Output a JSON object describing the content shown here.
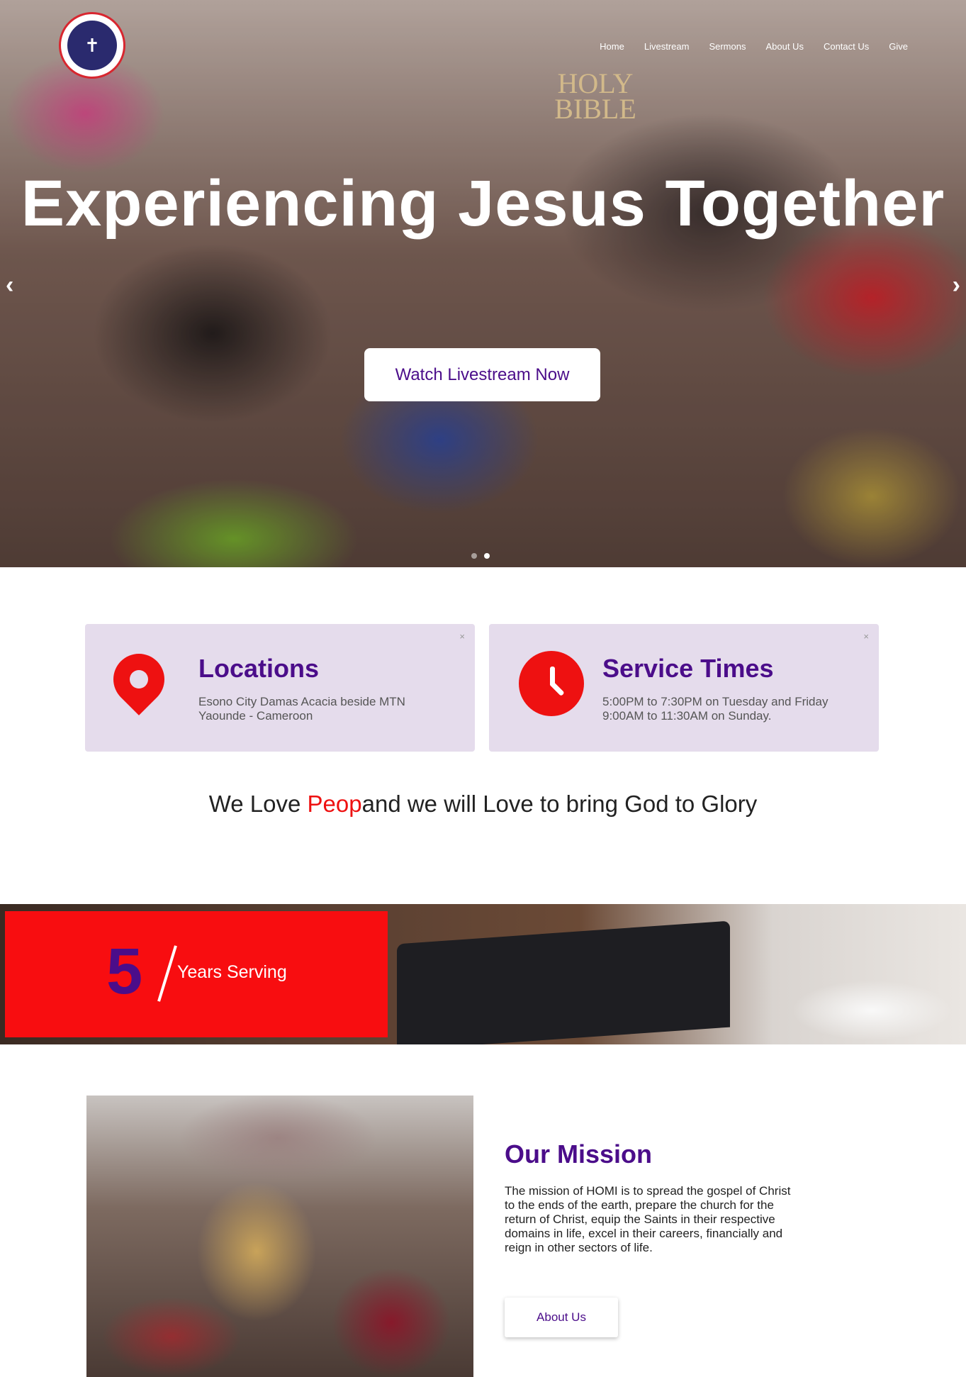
{
  "nav": {
    "items": [
      "Home",
      "Livestream",
      "Sermons",
      "About Us",
      "Contact Us",
      "Give"
    ]
  },
  "hero": {
    "title": "Experiencing Jesus Together",
    "cta": "Watch Livestream Now",
    "prev": "‹",
    "next": "›"
  },
  "cards": {
    "location": {
      "title": "Locations",
      "text": "Esono City Damas Acacia beside MTN Yaounde - Cameroon",
      "close": "×"
    },
    "service": {
      "title": "Service Times",
      "text": "5:00PM to 7:30PM on Tuesday and Friday 9:00AM to 11:30AM on Sunday.",
      "close": "×"
    }
  },
  "tagline": {
    "before": "We Love ",
    "highlight": "Peop",
    "after": "and we will Love to bring God to Glory"
  },
  "stats": {
    "number": "5",
    "label": "Years Serving",
    "book_text": "HOLY BIBLE"
  },
  "mission": {
    "title": "Our Mission",
    "text": "The mission of HOMI is to spread the gospel of Christ to the ends of the earth, prepare the church for the return of Christ, equip the Saints in their respective domains in life, excel in their careers, financially and reign in other sectors of life.",
    "button": "About Us"
  },
  "colors": {
    "brand_purple": "#4b0d8a",
    "accent_red": "#ee1111",
    "card_bg": "#e5dcec"
  }
}
